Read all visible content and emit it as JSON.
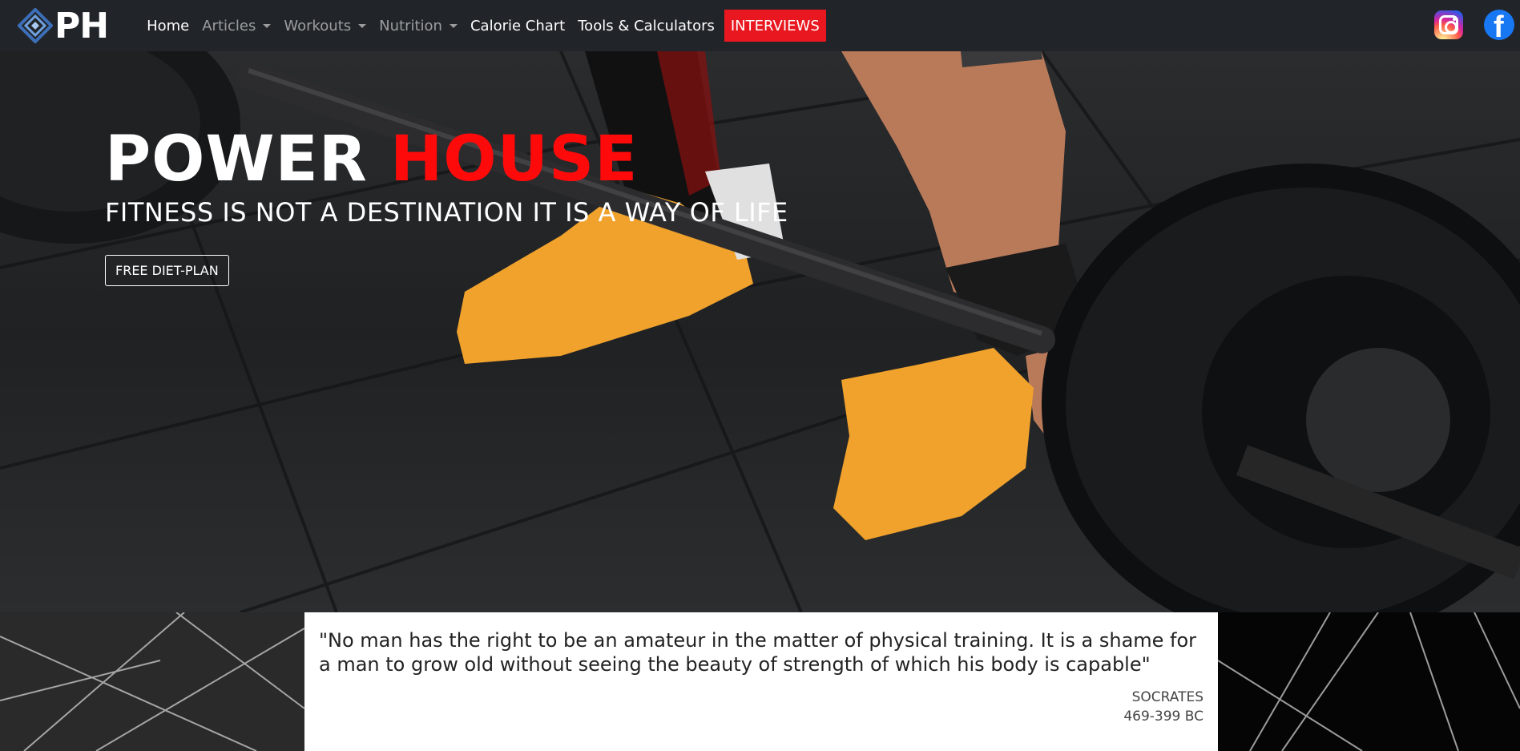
{
  "brand": {
    "text": "PH",
    "logo_icon": "diamond-logo-icon"
  },
  "nav": {
    "home": "Home",
    "articles": "Articles",
    "workouts": "Workouts",
    "nutrition": "Nutrition",
    "calorie_chart": "Calorie Chart",
    "tools": "Tools & Calculators",
    "interviews": "INTERVIEWS"
  },
  "social": {
    "instagram_icon": "instagram-icon",
    "facebook_icon": "facebook-icon"
  },
  "hero": {
    "title_part1": "POWER",
    "title_part2": "HOUSE",
    "subtitle": "FITNESS IS NOT A DESTINATION IT IS A WAY OF LIFE",
    "button": "FREE DIET-PLAN"
  },
  "quote": {
    "text": "\"No man has the right to be an amateur in the matter of physical training. It is a shame for a man to grow old without seeing the beauty of strength of which his body is capable\"",
    "author": "SOCRATES",
    "dates": "469-399 BC"
  },
  "colors": {
    "navbar": "#212529",
    "accent_red": "#ff0a0a",
    "interviews_bg": "#e9171f"
  }
}
